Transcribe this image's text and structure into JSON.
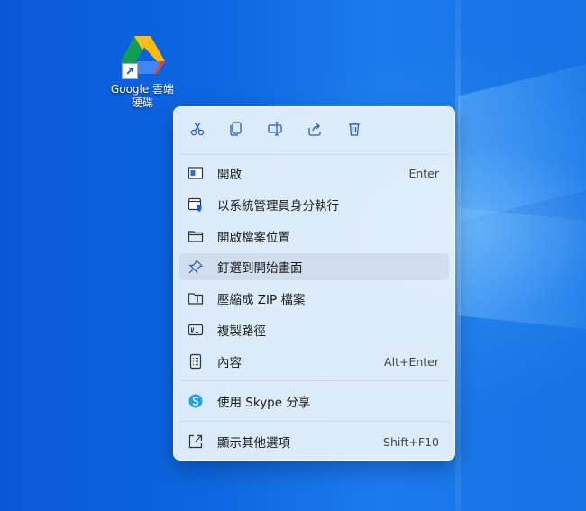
{
  "desktop": {
    "icon": {
      "label_line1": "Google 雲端",
      "label_line2": "硬碟"
    }
  },
  "context_menu": {
    "toolbar": [
      {
        "icon": "cut-icon"
      },
      {
        "icon": "copy-icon"
      },
      {
        "icon": "rename-icon"
      },
      {
        "icon": "share-icon"
      },
      {
        "icon": "delete-icon"
      }
    ],
    "items": [
      {
        "label": "開啟",
        "shortcut": "Enter",
        "icon": "open-icon"
      },
      {
        "label": "以系統管理員身分執行",
        "shortcut": "",
        "icon": "run-as-admin-icon"
      },
      {
        "label": "開啟檔案位置",
        "shortcut": "",
        "icon": "folder-icon"
      },
      {
        "label": "釘選到開始畫面",
        "shortcut": "",
        "icon": "pin-icon"
      },
      {
        "label": "壓縮成 ZIP 檔案",
        "shortcut": "",
        "icon": "zip-icon"
      },
      {
        "label": "複製路徑",
        "shortcut": "",
        "icon": "copy-path-icon"
      },
      {
        "label": "內容",
        "shortcut": "Alt+Enter",
        "icon": "properties-icon"
      },
      {
        "label": "使用 Skype 分享",
        "shortcut": "",
        "icon": "skype-icon"
      },
      {
        "label": "顯示其他選項",
        "shortcut": "Shift+F10",
        "icon": "more-options-icon"
      }
    ]
  },
  "colors": {
    "accent": "#2b5bb8",
    "menu_bg": "#e5f0fb",
    "skype": "#1da1e8"
  }
}
